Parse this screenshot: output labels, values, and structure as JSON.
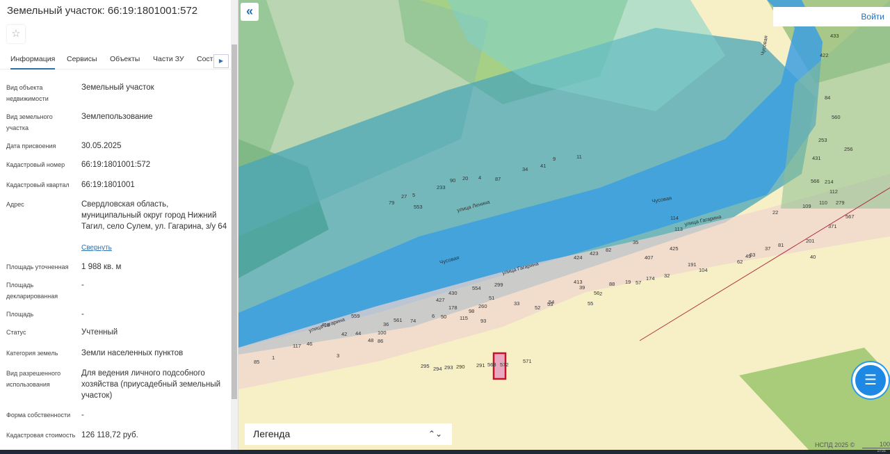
{
  "panel": {
    "title": "Земельный участок: 66:19:1801001:572",
    "favorite_icon": "star-icon",
    "tabs": [
      "Информация",
      "Сервисы",
      "Объекты",
      "Части ЗУ",
      "Состав"
    ],
    "fields": [
      {
        "label": "Вид объекта недвижимости",
        "value": "Земельный участок"
      },
      {
        "label": "Вид земельного участка",
        "value": "Землепользование"
      },
      {
        "label": "Дата присвоения",
        "value": "30.05.2025"
      },
      {
        "label": "Кадастровый номер",
        "value": "66:19:1801001:572"
      },
      {
        "label": "Кадастровый квартал",
        "value": "66:19:1801001"
      },
      {
        "label": "Адрес",
        "value": "Свердловская область, муниципальный округ город Нижний Тагил, село Сулем, ул. Гагарина, з/у 64"
      },
      {
        "label": "Площадь уточненная",
        "value": "1 988 кв. м"
      },
      {
        "label": "Площадь декларированная",
        "value": "-"
      },
      {
        "label": "Площадь",
        "value": "-"
      },
      {
        "label": "Статус",
        "value": "Учтенный"
      },
      {
        "label": "Категория земель",
        "value": "Земли населенных пунктов"
      },
      {
        "label": "Вид разрешенного использования",
        "value": "Для ведения личного подсобного хозяйства (приусадебный земельный участок)"
      },
      {
        "label": "Форма собственности",
        "value": "-"
      },
      {
        "label": "Кадастровая стоимость",
        "value": "126 118,72 руб."
      }
    ],
    "collapse_link": "Свернуть"
  },
  "map": {
    "login": "Войти",
    "legend": "Легенда",
    "copyright": "НСПД 2025 ©",
    "scale": "100",
    "streets": [
      "улица Ленина",
      "улица Гагарина",
      "улица Гагарина",
      "улица Гагарина",
      "Чусовая",
      "Чусовая",
      "Чусовая"
    ],
    "parcels": [
      "79",
      "27",
      "5",
      "553",
      "233",
      "90",
      "20",
      "4",
      "87",
      "34",
      "41",
      "9",
      "11",
      "430",
      "554",
      "299",
      "51",
      "33",
      "52",
      "53",
      "54",
      "427",
      "178",
      "98",
      "260",
      "6",
      "50",
      "115",
      "93",
      "559",
      "410",
      "117",
      "46",
      "42",
      "44",
      "48",
      "86",
      "36",
      "100",
      "561",
      "74",
      "3",
      "85",
      "1",
      "413",
      "39",
      "56",
      "2",
      "88",
      "19",
      "57",
      "174",
      "32",
      "424",
      "423",
      "82",
      "35",
      "407",
      "425",
      "191",
      "104",
      "62",
      "49",
      "63",
      "37",
      "81",
      "201",
      "40",
      "371",
      "567",
      "279",
      "110",
      "109",
      "22",
      "114",
      "113",
      "295",
      "294",
      "293",
      "290",
      "291",
      "568",
      "572",
      "571",
      "433",
      "422",
      "84",
      "560",
      "253",
      "256",
      "431",
      "566",
      "214",
      "112",
      "55"
    ],
    "selected_parcel": "572",
    "colors": {
      "water": "#4fb3e8",
      "zone": "#5fb0b0",
      "greens": "#7fb86a",
      "selected": "#c8102e"
    }
  },
  "taskbar": {
    "clock": "17:21"
  }
}
